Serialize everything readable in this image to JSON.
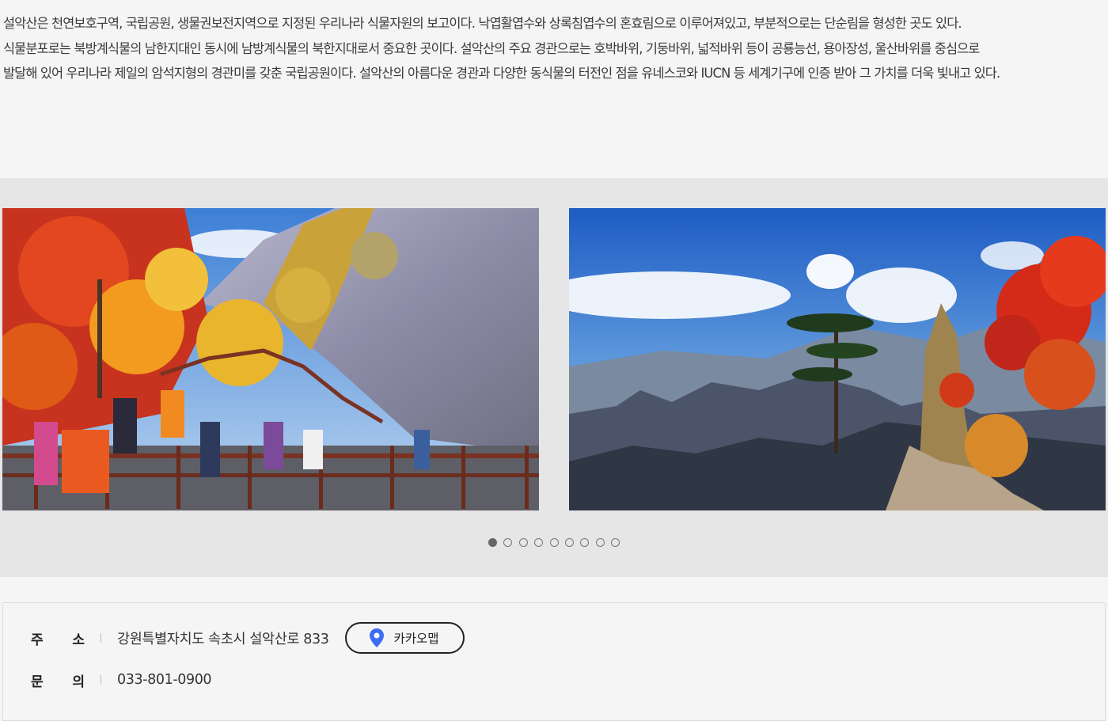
{
  "intro": {
    "lines": [
      "설악산은 천연보호구역, 국립공원, 생물권보전지역으로 지정된 우리나라 식물자원의 보고이다. 낙엽활엽수와 상록침엽수의 혼효림으로 이루어져있고, 부분적으로는 단순림을 형성한 곳도 있다.",
      "식물분포로는 북방계식물의 남한지대인 동시에 남방계식물의 북한지대로서 중요한 곳이다. 설악산의 주요 경관으로는 호박바위, 기둥바위, 넓적바위 등이 공룡능선, 용아장성, 울산바위를 중심으로",
      "발달해 있어 우리나라 제일의 암석지형의 경관미를 갖춘 국립공원이다. 설악산의 아름다운 경관과 다양한 동식물의 터전인 점을 유네스코와 IUCN 등 세계기구에 인증 받아 그 가치를 더욱 빛내고 있다."
    ]
  },
  "gallery": {
    "slides": [
      {
        "name": "autumn-trail-photo"
      },
      {
        "name": "mountain-peak-photo"
      }
    ],
    "dots_count": 9,
    "active_dot": 0
  },
  "info": {
    "address": {
      "label_chars": [
        "주",
        "소"
      ],
      "value": "강원특별자치도 속초시 설악산로 833",
      "map_button_label": "카카오맵",
      "map_icon": "map-pin-icon",
      "map_icon_color": "#3b6cf6"
    },
    "contact": {
      "label_chars": [
        "문",
        "의"
      ],
      "value": "033-801-0900"
    }
  }
}
